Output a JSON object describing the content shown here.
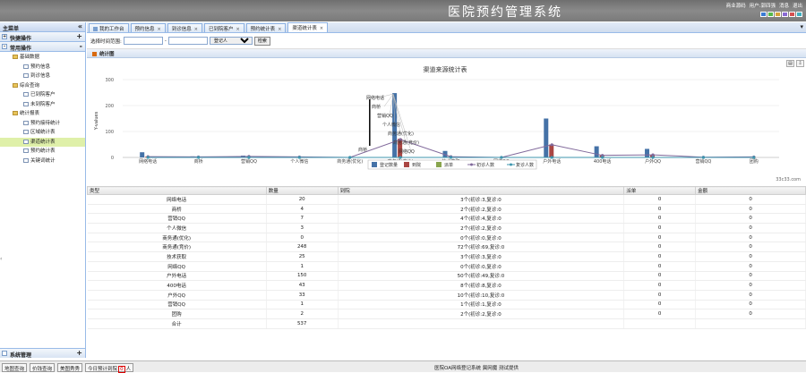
{
  "app": {
    "title": "医院预约管理系统",
    "links": [
      "商业源码",
      "用户:郭四强",
      "消息",
      "退出"
    ],
    "swatches": [
      "#3b7bd4",
      "#54b84a",
      "#d4a23b",
      "#8a6ad4",
      "#d45050",
      "#40b0c0"
    ]
  },
  "sidebar": {
    "title": "主菜单",
    "collapse_icon": "«",
    "quick": "快捷操作",
    "common": "常用操作",
    "system": "系统管理",
    "tree": [
      {
        "label": "基础数据",
        "type": "folder",
        "indent": 1
      },
      {
        "label": "预约信息",
        "type": "leaf",
        "indent": 2
      },
      {
        "label": "到诊信息",
        "type": "leaf",
        "indent": 2
      },
      {
        "label": "综合查询",
        "type": "folder",
        "indent": 1
      },
      {
        "label": "已到院客户",
        "type": "leaf",
        "indent": 2
      },
      {
        "label": "未到院客户",
        "type": "leaf",
        "indent": 2
      },
      {
        "label": "统计报表",
        "type": "folder",
        "indent": 1
      },
      {
        "label": "预约接待统计",
        "type": "leaf",
        "indent": 2
      },
      {
        "label": "区域统计表",
        "type": "leaf",
        "indent": 2
      },
      {
        "label": "渠道统计表",
        "type": "leaf",
        "indent": 2,
        "selected": true
      },
      {
        "label": "预约统计表",
        "type": "leaf",
        "indent": 2
      },
      {
        "label": "关键词统计",
        "type": "leaf",
        "indent": 2
      }
    ]
  },
  "tabs": [
    {
      "label": "我的工作台",
      "active": false
    },
    {
      "label": "预约信息",
      "active": false
    },
    {
      "label": "到诊信息",
      "active": false
    },
    {
      "label": "已到院客户",
      "active": false
    },
    {
      "label": "预约统计表",
      "active": false
    },
    {
      "label": "渠道统计表",
      "active": true
    }
  ],
  "filter": {
    "label": "选择时间范围:",
    "separator": "-",
    "select_value": "登记人",
    "search": "检索"
  },
  "panel": {
    "title": "统计图"
  },
  "chart_data": {
    "type": "bar",
    "title": "渠道来源统计表",
    "ylabel": "Y-values",
    "ylim": [
      0,
      300
    ],
    "yticks": [
      0,
      100,
      200,
      300
    ],
    "categories": [
      "网络电话",
      "商桥",
      "营销QQ",
      "个人微信",
      "商务通(优化)",
      "商务通(竞价)",
      "技术获取",
      "网络QQ",
      "户外电话",
      "400电话",
      "户外QQ",
      "营销QQ",
      "团购"
    ],
    "series": [
      {
        "name": "登记数量",
        "type": "bar",
        "color": "#4572a7",
        "values": [
          20,
          4,
          7,
          3,
          0,
          248,
          25,
          1,
          150,
          43,
          33,
          1,
          2
        ]
      },
      {
        "name": "到院",
        "type": "bar",
        "color": "#aa4643",
        "values": [
          3,
          2,
          4,
          2,
          0,
          72,
          3,
          0,
          50,
          8,
          10,
          1,
          2
        ]
      },
      {
        "name": "派单",
        "type": "bar",
        "color": "#89a54e",
        "values": [
          0,
          0,
          0,
          0,
          0,
          0,
          0,
          0,
          0,
          0,
          0,
          0,
          0
        ]
      },
      {
        "name": "初诊人数",
        "type": "line",
        "color": "#80699b",
        "values": [
          3,
          2,
          4,
          2,
          0,
          69,
          3,
          0,
          49,
          8,
          10,
          1,
          2
        ]
      },
      {
        "name": "复诊人数",
        "type": "line",
        "color": "#3d96ae",
        "values": [
          0,
          0,
          0,
          0,
          0,
          0,
          0,
          0,
          0,
          0,
          0,
          0,
          0
        ]
      }
    ],
    "callouts": [
      "网络电话",
      "商桥",
      "营销QQ",
      "个人微信",
      "商务通(优化)",
      "商务通(竞价)",
      "网络QQ"
    ],
    "export_icons": [
      "print-icon",
      "download-icon"
    ],
    "credit": "33c33.com"
  },
  "table": {
    "headers": [
      "类型",
      "数量",
      "到院",
      "派单",
      "金额"
    ],
    "rows": [
      [
        "网络电话",
        "20",
        "3个(初诊:3,复诊:0",
        "0",
        "0"
      ],
      [
        "商桥",
        "4",
        "2个(初诊:2,复诊:0",
        "0",
        "0"
      ],
      [
        "营销QQ",
        "7",
        "4个(初诊:4,复诊:0",
        "0",
        "0"
      ],
      [
        "个人微信",
        "3",
        "2个(初诊:2,复诊:0",
        "0",
        "0"
      ],
      [
        "商务通(优化)",
        "0",
        "0个(初诊:0,复诊:0",
        "0",
        "0"
      ],
      [
        "商务通(竞价)",
        "248",
        "72个(初诊:69,复诊:0",
        "0",
        "0"
      ],
      [
        "技术获取",
        "25",
        "3个(初诊:3,复诊:0",
        "0",
        "0"
      ],
      [
        "网络QQ",
        "1",
        "0个(初诊:0,复诊:0",
        "0",
        "0"
      ],
      [
        "户外电话",
        "150",
        "50个(初诊:49,复诊:0",
        "0",
        "0"
      ],
      [
        "400电话",
        "43",
        "8个(初诊:8,复诊:0",
        "0",
        "0"
      ],
      [
        "户外QQ",
        "33",
        "10个(初诊:10,复诊:0",
        "0",
        "0"
      ],
      [
        "营销QQ",
        "1",
        "1个(初诊:1,复诊:0",
        "0",
        "0"
      ],
      [
        "团购",
        "2",
        "2个(初诊:2,复诊:0",
        "0",
        "0"
      ],
      [
        "合计",
        "537",
        "",
        "",
        ""
      ]
    ]
  },
  "statusbar": {
    "buttons": [
      "地图查询",
      "价钱查询",
      "美图秀秀"
    ],
    "today_label": "今日预计到院",
    "today_count": "0",
    "today_unit": "人",
    "footer": "医院OA网络登记系统 冀网魔 测试提供"
  }
}
